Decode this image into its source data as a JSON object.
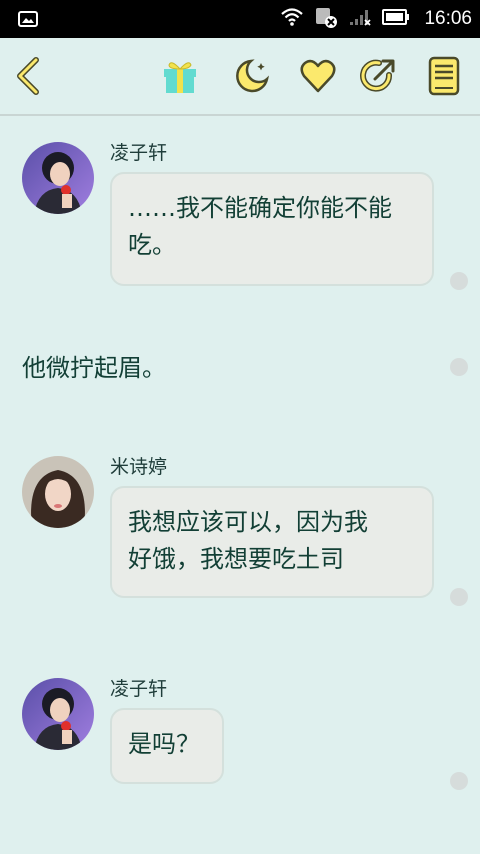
{
  "status_bar": {
    "time": "16:06"
  },
  "messages": [
    {
      "type": "chat",
      "name": "凌子轩",
      "line1": "……我不能确定你能不能",
      "line2": "吃。"
    },
    {
      "type": "narration",
      "text": "他微拧起眉。"
    },
    {
      "type": "chat",
      "name": "米诗婷",
      "line1": "我想应该可以，因为我",
      "line2": "好饿，我想要吃土司"
    },
    {
      "type": "chat",
      "name": "凌子轩",
      "line1": "是吗？"
    }
  ],
  "colors": {
    "background": "#dff0ee",
    "bubble": "#e9ece8",
    "text": "#123f35",
    "icon_yellow": "#fbe96d",
    "icon_outline": "#4a4a2a"
  }
}
